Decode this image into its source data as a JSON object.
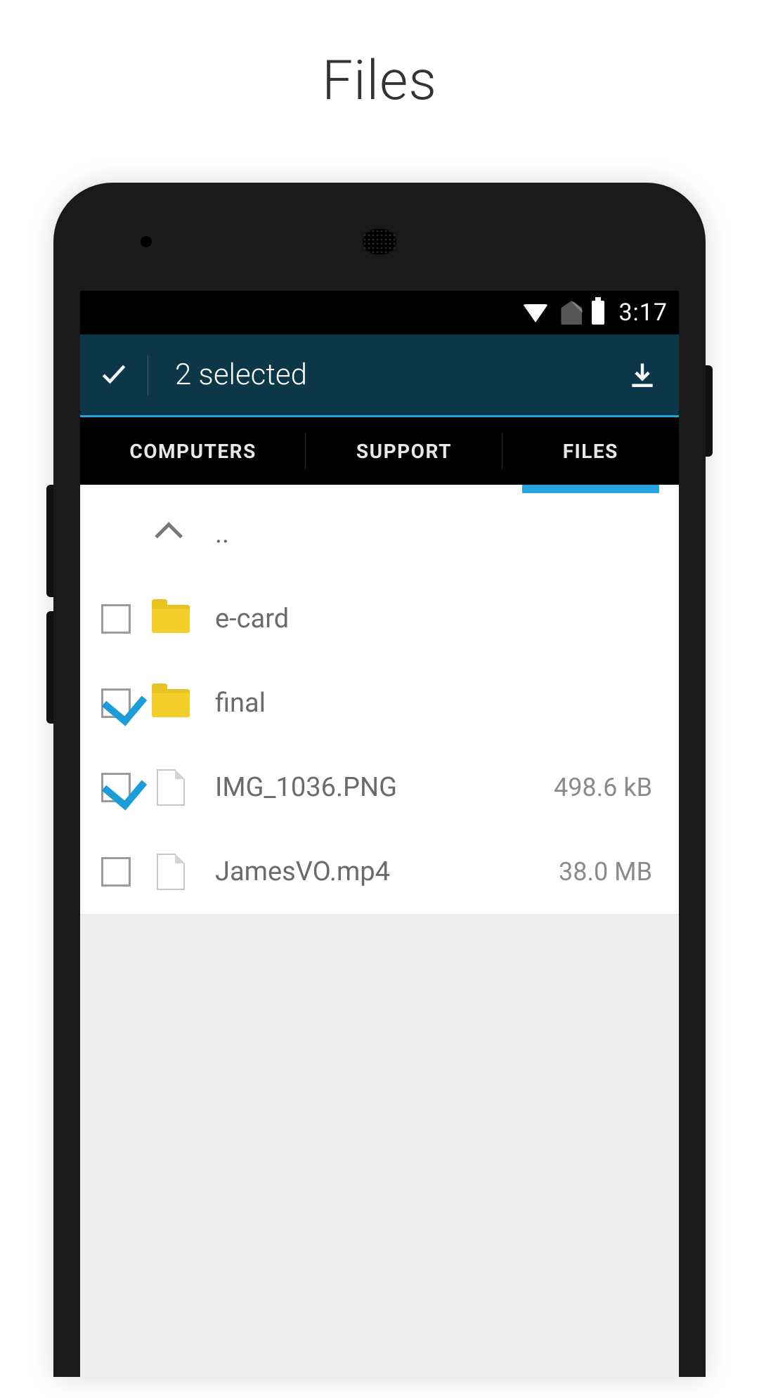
{
  "page_title": "Files",
  "statusbar": {
    "time": "3:17"
  },
  "actionbar": {
    "title": "2 selected"
  },
  "tabs": {
    "items": [
      {
        "label": "COMPUTERS",
        "active": false
      },
      {
        "label": "SUPPORT",
        "active": false
      },
      {
        "label": "FILES",
        "active": true
      }
    ]
  },
  "list": {
    "up_label": "..",
    "rows": [
      {
        "type": "folder",
        "name": "e-card",
        "size": "",
        "checked": false
      },
      {
        "type": "folder",
        "name": "final",
        "size": "",
        "checked": true
      },
      {
        "type": "file",
        "name": "IMG_1036.PNG",
        "size": "498.6 kB",
        "checked": true
      },
      {
        "type": "file",
        "name": "JamesVO.mp4",
        "size": "38.0 MB",
        "checked": false
      }
    ]
  }
}
